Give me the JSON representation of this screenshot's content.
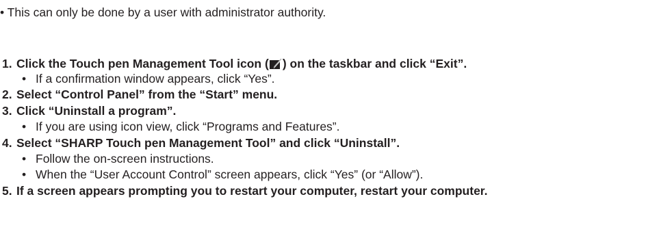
{
  "intro_note": "• This can only be done by a user with administrator authority.",
  "steps": [
    {
      "number": "1.",
      "text_before_icon": "Click the Touch pen Management Tool icon (",
      "text_after_icon": ") on the taskbar and click “Exit”.",
      "icon": "touch-pen-management-tool-icon",
      "notes": [
        "If a confirmation window appears, click “Yes”."
      ]
    },
    {
      "number": "2.",
      "text": "Select “Control Panel” from the “Start” menu.",
      "notes": []
    },
    {
      "number": "3.",
      "text": "Click “Uninstall a program”.",
      "notes": [
        "If you are using icon view, click “Programs and Features”."
      ]
    },
    {
      "number": "4.",
      "text": "Select “SHARP Touch pen Management Tool” and click “Uninstall”.",
      "notes": [
        "Follow the on-screen instructions.",
        "When the “User Account Control” screen appears, click “Yes” (or “Allow”)."
      ]
    },
    {
      "number": "5.",
      "text": "If a screen appears prompting you to restart your computer, restart your computer.",
      "notes": []
    }
  ],
  "bullet_char": "•",
  "colors": {
    "text": "#231f20",
    "icon_dark": "#231f20",
    "icon_light": "#b0b0b0"
  }
}
